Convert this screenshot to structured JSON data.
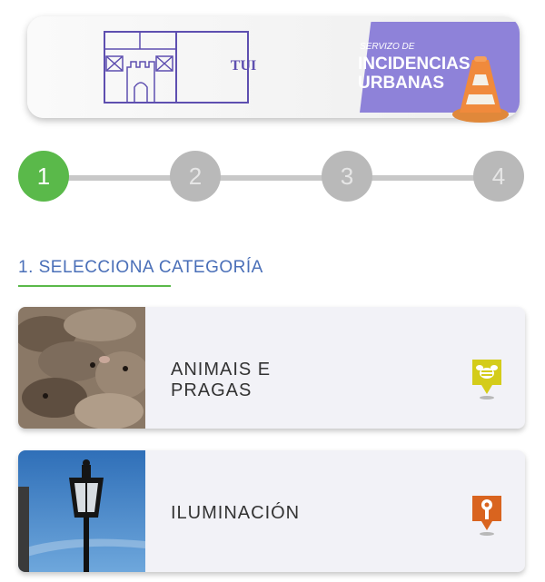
{
  "banner": {
    "logo_text": "TUI",
    "service_small": "SERVIZO DE",
    "service_line1": "INCIDENCIAS",
    "service_line2": "URBANAS"
  },
  "stepper": {
    "steps": [
      "1",
      "2",
      "3",
      "4"
    ],
    "active": 1
  },
  "section": {
    "title": "1. SELECCIONA CATEGORÍA"
  },
  "categories": [
    {
      "line1": "ANIMAIS E",
      "line2": "PRAGAS",
      "icon": "bee-icon",
      "icon_color": "#d4cc1a"
    },
    {
      "line1": "ILUMINACIÓN",
      "line2": "",
      "icon": "streetlight-icon",
      "icon_color": "#d9641f"
    }
  ],
  "colors": {
    "accent_green": "#5ab94a",
    "title_blue": "#4a6fb8",
    "banner_purple": "#8e82d9"
  }
}
